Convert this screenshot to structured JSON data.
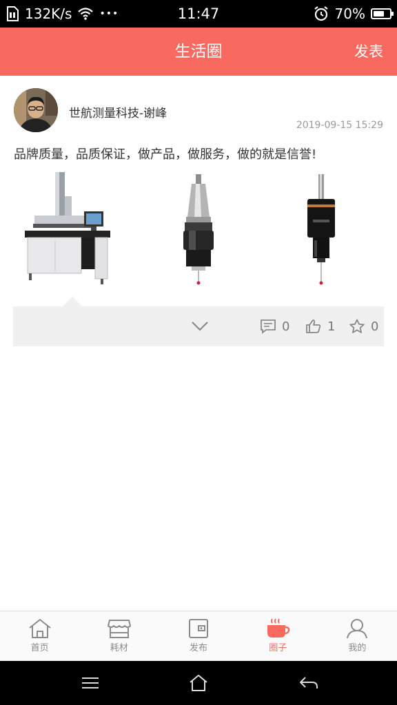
{
  "status_bar": {
    "network_speed": "132K/s",
    "dots": "•••",
    "time": "11:47",
    "battery_percent": "70%",
    "battery_level": 0.7
  },
  "header": {
    "title": "生活圈",
    "action_label": "发表"
  },
  "post": {
    "author": "世航测量科技-谢峰",
    "time": "2019-09-15 15:29",
    "text": "品牌质量，品质保证，做产品，做服务，做的就是信誉!",
    "images": [
      "vision-measuring-machine",
      "cnc-touch-probe-bt-holder",
      "cnc-touch-probe-cylinder"
    ],
    "comments": "0",
    "likes": "1",
    "favorites": "0"
  },
  "bottom_nav": [
    {
      "label": "首页",
      "icon": "home-icon"
    },
    {
      "label": "耗材",
      "icon": "store-icon"
    },
    {
      "label": "发布",
      "icon": "wallet-icon"
    },
    {
      "label": "圈子",
      "icon": "coffee-cup-icon",
      "active": true
    },
    {
      "label": "我的",
      "icon": "user-icon"
    }
  ],
  "colors": {
    "accent": "#f86a60",
    "nav_inactive": "#8a8a8a",
    "action_bg": "#f0f0f0"
  }
}
